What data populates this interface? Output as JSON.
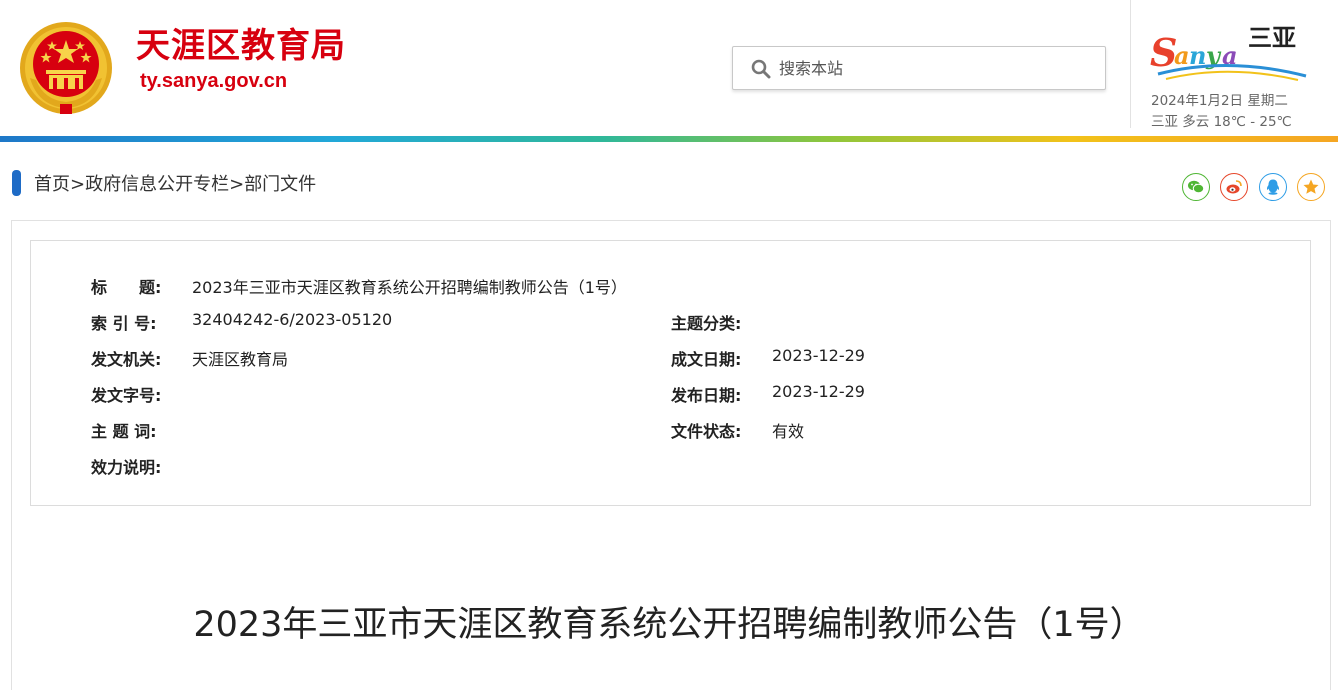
{
  "header": {
    "site_title": "天涯区教育局",
    "site_domain": "ty.sanya.gov.cn",
    "emblem_icon": "national-emblem-icon",
    "search": {
      "placeholder": "搜索本站",
      "icon": "search-icon"
    },
    "logo": {
      "latin": "Sanya",
      "chinese": "三亚",
      "icon": "sanya-city-logo"
    },
    "date": "2024年1月2日 星期二",
    "weather": "三亚  多云  18℃ - 25℃"
  },
  "breadcrumb": {
    "home": "首页",
    "sep": ">",
    "section": "政府信息公开专栏",
    "current": "部门文件"
  },
  "share": [
    {
      "name": "wechat-share",
      "icon": "wechat-icon",
      "color": "#4fb634"
    },
    {
      "name": "weibo-share",
      "icon": "weibo-icon",
      "color": "#e6462a"
    },
    {
      "name": "qq-share",
      "icon": "qq-icon",
      "color": "#2e9de6"
    },
    {
      "name": "favorite",
      "icon": "star-icon",
      "color": "#f5a623"
    }
  ],
  "info": {
    "title_label": "标　　题:",
    "title_value": "2023年三亚市天涯区教育系统公开招聘编制教师公告（1号）",
    "index_label": "索 引 号:",
    "index_value": "32404242-6/2023-05120",
    "category_label": "主题分类:",
    "category_value": "",
    "issuer_label": "发文机关:",
    "issuer_value": "天涯区教育局",
    "written_date_label": "成文日期:",
    "written_date_value": "2023-12-29",
    "docno_label": "发文字号:",
    "docno_value": "",
    "publish_date_label": "发布日期:",
    "publish_date_value": "2023-12-29",
    "keywords_label": "主 题 词:",
    "keywords_value": "",
    "status_label": "文件状态:",
    "status_value": "有效",
    "validity_label": "效力说明:",
    "validity_value": ""
  },
  "doc_title": "2023年三亚市天涯区教育系统公开招聘编制教师公告（1号）",
  "colors": {
    "brand_red": "#d7000f",
    "accent_blue": "#1e6bc6"
  }
}
